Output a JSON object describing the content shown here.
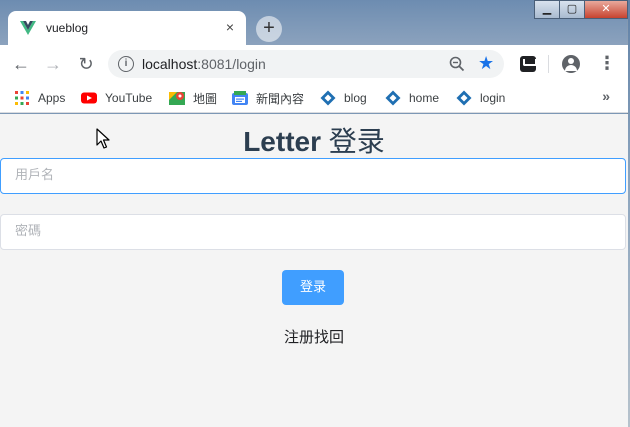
{
  "window": {
    "controls": {
      "minimize": "▁",
      "maximize": "▢",
      "close": "✕"
    }
  },
  "tab": {
    "title": "vueblog",
    "favicon": "vue-logo-icon",
    "close": "×"
  },
  "newtab_label": "+",
  "toolbar": {
    "back": "←",
    "forward": "→",
    "reload": "↻",
    "url_host": "localhost",
    "url_rest": ":8081/login",
    "star": "★",
    "menu": "⋮",
    "info": "i"
  },
  "bookmarks": [
    {
      "label": "Apps",
      "icon": "apps-grid-icon"
    },
    {
      "label": "YouTube",
      "icon": "youtube-icon"
    },
    {
      "label": "地圖",
      "icon": "maps-icon"
    },
    {
      "label": "新聞內容",
      "icon": "news-icon"
    },
    {
      "label": "blog",
      "icon": "diamond-icon"
    },
    {
      "label": "home",
      "icon": "diamond-icon"
    },
    {
      "label": "login",
      "icon": "diamond-icon"
    }
  ],
  "bookmarks_more": "»",
  "page": {
    "title_bold": "Letter",
    "title_rest": " 登录",
    "username_placeholder": "用戶名",
    "password_placeholder": "密碼",
    "login_button": "登录",
    "register": "注册",
    "recover": "找回"
  },
  "colors": {
    "accent": "#409eff",
    "title": "#2c3e50",
    "page_bg": "#f4f4f4"
  }
}
